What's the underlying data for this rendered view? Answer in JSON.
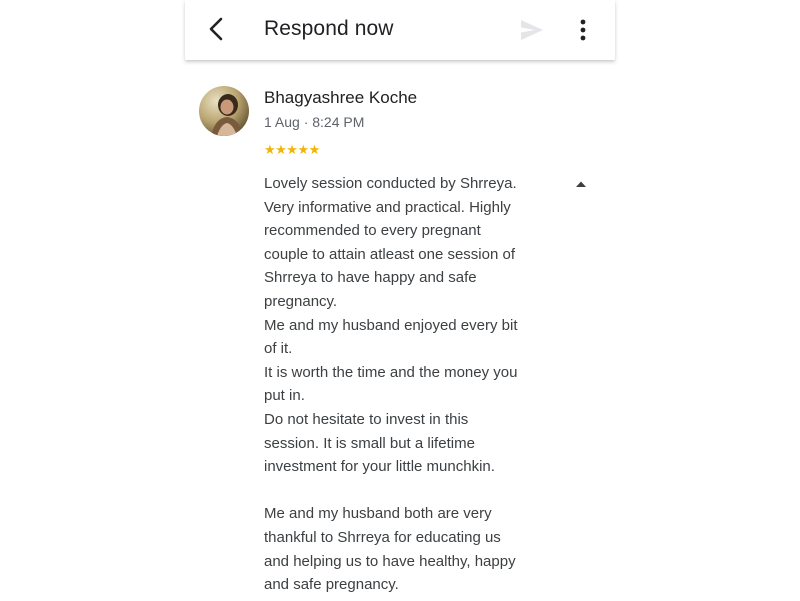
{
  "header": {
    "title": "Respond now",
    "icons": {
      "back": "back-arrow-icon",
      "send": "send-icon",
      "more": "more-vert-icon"
    },
    "send_color": "#e3e5e8"
  },
  "review": {
    "reviewer_name": "Bhagyashree Koche",
    "date_time": "1 Aug · 8:24 PM",
    "rating": 5,
    "stars_text": "★★★★★",
    "star_color": "#f4b400",
    "text_lines": [
      "Lovely session conducted by Shrreya.",
      "Very informative and practical. Highly",
      "recommended to every pregnant",
      "couple to attain atleast one session of",
      "Shrreya to have happy and safe",
      "pregnancy.",
      "Me and my husband enjoyed every bit",
      "of it.",
      "It is worth the time and the money you",
      "put in.",
      "Do not hesitate to invest in this",
      "session. It is small but a lifetime",
      "investment for your little munchkin.",
      "",
      "Me and my husband both are very",
      "thankful to Shrreya for educating us",
      "and helping us to have healthy, happy",
      "and safe pregnancy."
    ],
    "collapse_icon": "collapse-triangle-icon"
  }
}
